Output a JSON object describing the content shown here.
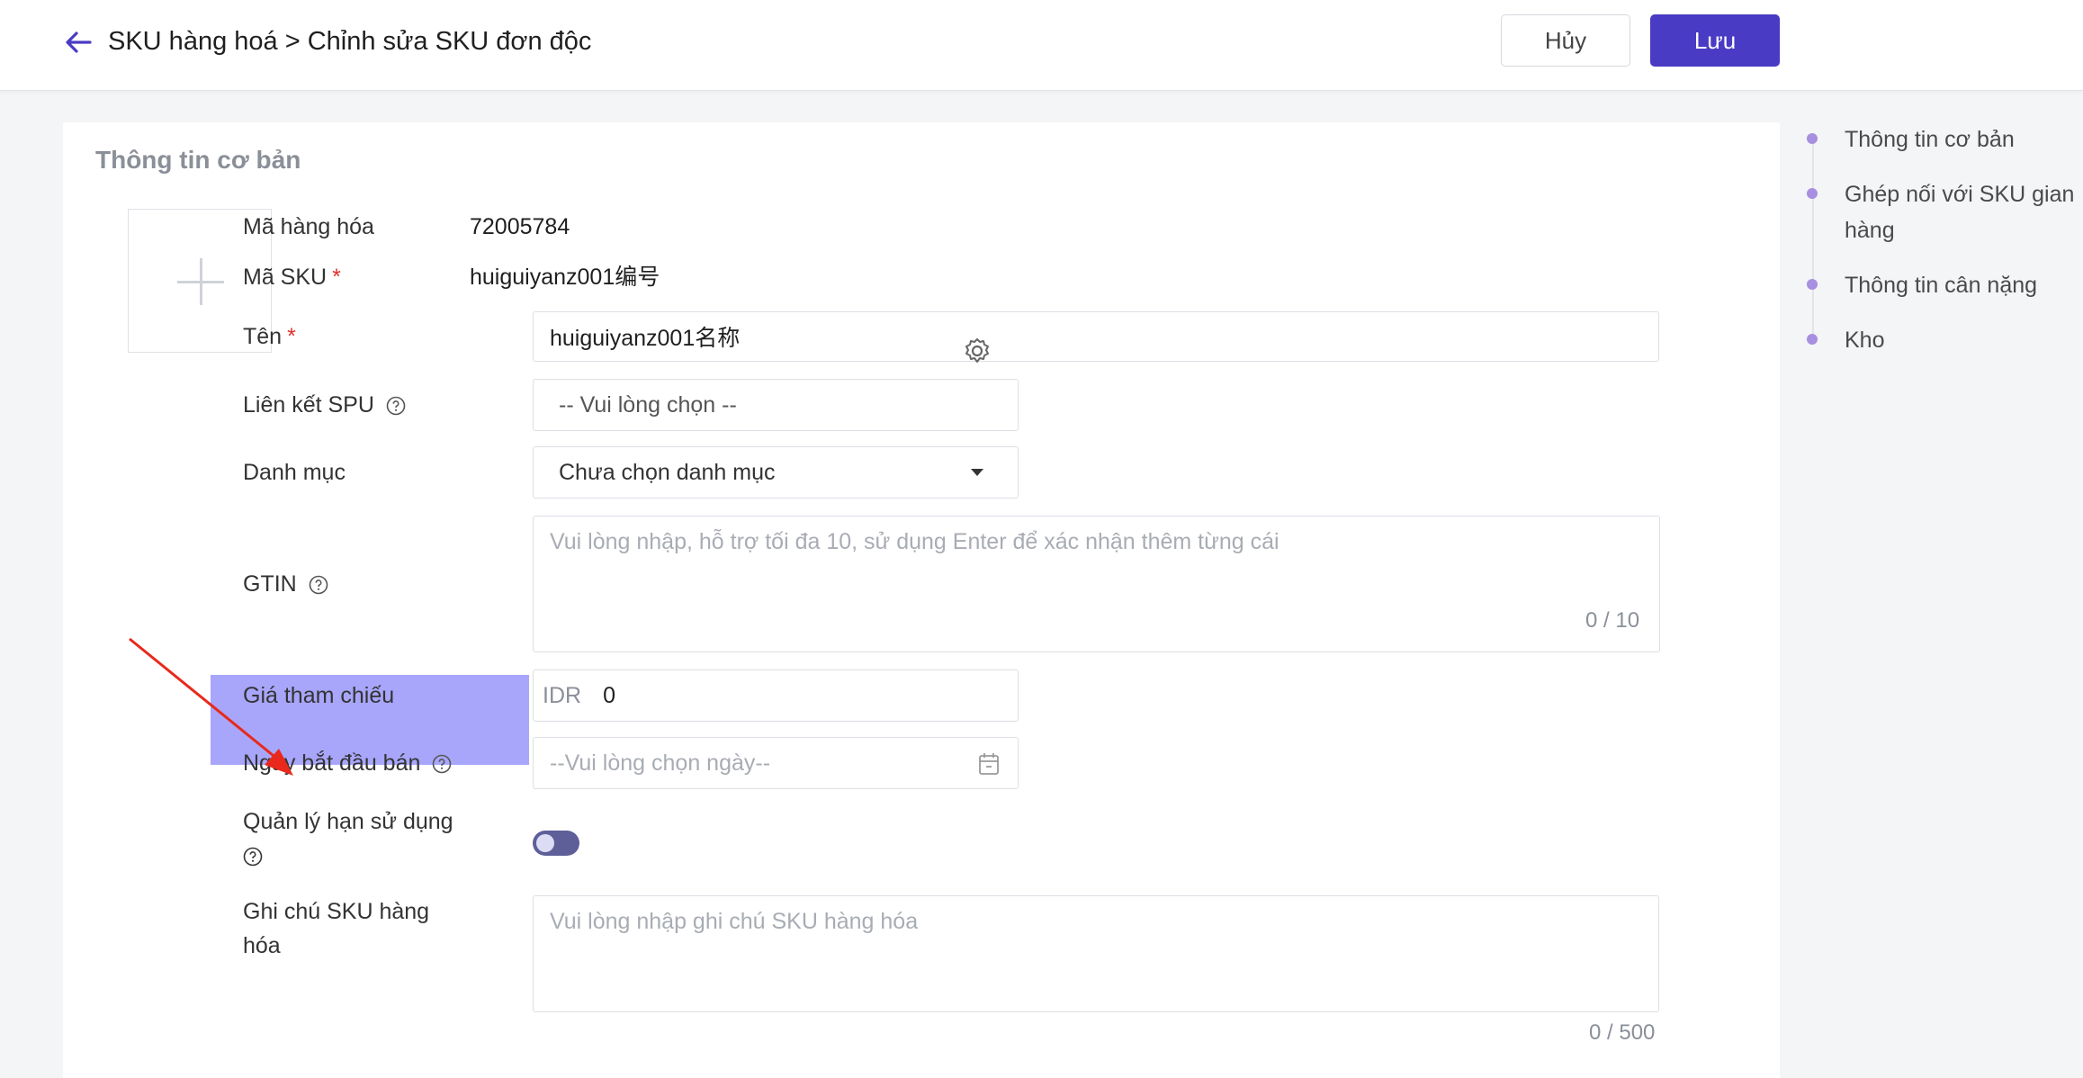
{
  "header": {
    "breadcrumb": "SKU hàng hoá > Chỉnh sửa SKU đơn độc",
    "cancel_label": "Hủy",
    "save_label": "Lưu"
  },
  "section": {
    "title": "Thông tin cơ bản"
  },
  "form": {
    "product_code_label": "Mã hàng hóa",
    "product_code_value": "72005784",
    "sku_code_label": "Mã SKU",
    "sku_code_value": "huiguiyanz001编号",
    "name_label": "Tên",
    "name_value": "huiguiyanz001名称",
    "spu_label": "Liên kết SPU",
    "spu_placeholder": "-- Vui lòng chọn --",
    "category_label": "Danh mục",
    "category_value": "Chưa chọn danh mục",
    "gtin_label": "GTIN",
    "gtin_placeholder": "Vui lòng nhập, hỗ trợ tối đa 10, sử dụng Enter để xác nhận thêm từng cái",
    "gtin_counter": "0 / 10",
    "ref_price_label": "Giá tham chiếu",
    "ref_price_currency": "IDR",
    "ref_price_value": "0",
    "sale_start_label": "Ngày bắt đầu bán",
    "sale_start_placeholder": "--Vui lòng chọn ngày--",
    "expiry_mgmt_label": "Quản lý hạn sử dụng",
    "expiry_mgmt_enabled": false,
    "note_label": "Ghi chú SKU hàng hóa",
    "note_placeholder": "Vui lòng nhập ghi chú SKU hàng hóa",
    "note_counter": "0 / 500"
  },
  "toc": {
    "items": [
      "Thông tin cơ bản",
      "Ghép nối với SKU gian hàng",
      "Thông tin cân nặng",
      "Kho"
    ]
  },
  "colors": {
    "accent": "#4a3bc4",
    "highlight": "#a8a6fb",
    "annotation_arrow": "#e8291c"
  }
}
